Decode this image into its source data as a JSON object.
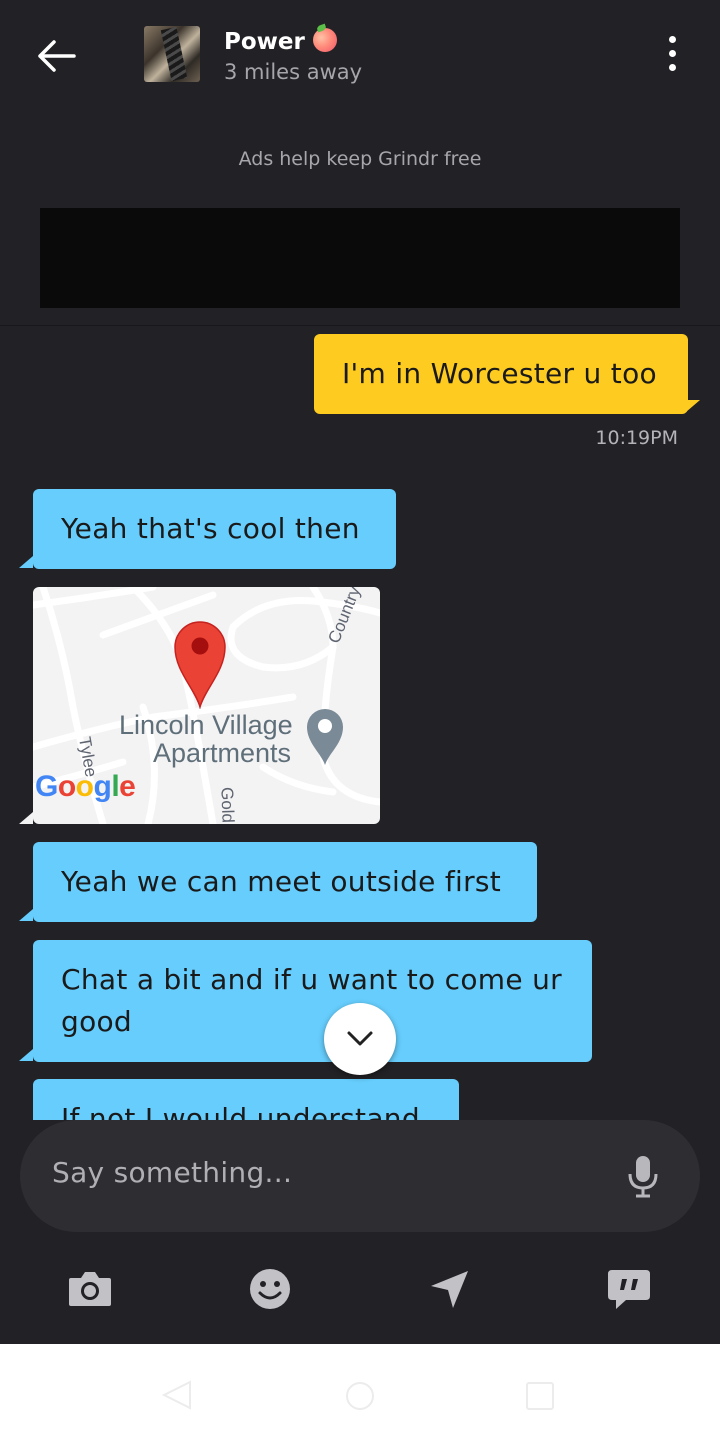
{
  "header": {
    "name": "Power",
    "distance": "3 miles away"
  },
  "ad": {
    "text": "Ads help keep Grindr free"
  },
  "messages": [
    {
      "text": "I'm in Worcester u too",
      "from": "me"
    },
    {
      "text": "10:19PM",
      "type": "timestamp"
    },
    {
      "text": "Yeah that's cool then",
      "from": "them"
    },
    {
      "text": "Yeah we can meet outside first",
      "from": "them"
    },
    {
      "text": "Chat a bit and if u want to come ur good",
      "from": "them"
    },
    {
      "text": "If not I would understand",
      "from": "them"
    }
  ],
  "map": {
    "place": "Lincoln Village Apartments",
    "place_line1": "Lincoln Village",
    "place_line2": "Apartments",
    "streets": [
      "Country",
      "Tylee",
      "Gold"
    ],
    "logo": "Google"
  },
  "input": {
    "placeholder": "Say something..."
  },
  "colors": {
    "background": "#222226",
    "outgoing_bubble": "#fecb21",
    "incoming_bubble": "#66cdfc"
  },
  "icons": {
    "back": "arrow-left-icon",
    "more": "kebab-menu-icon",
    "mic": "microphone-icon",
    "camera": "camera-icon",
    "emoji": "emoji-icon",
    "location": "location-arrow-icon",
    "saved_phrases": "quote-bubble-icon",
    "scroll_down": "chevron-down-icon"
  }
}
